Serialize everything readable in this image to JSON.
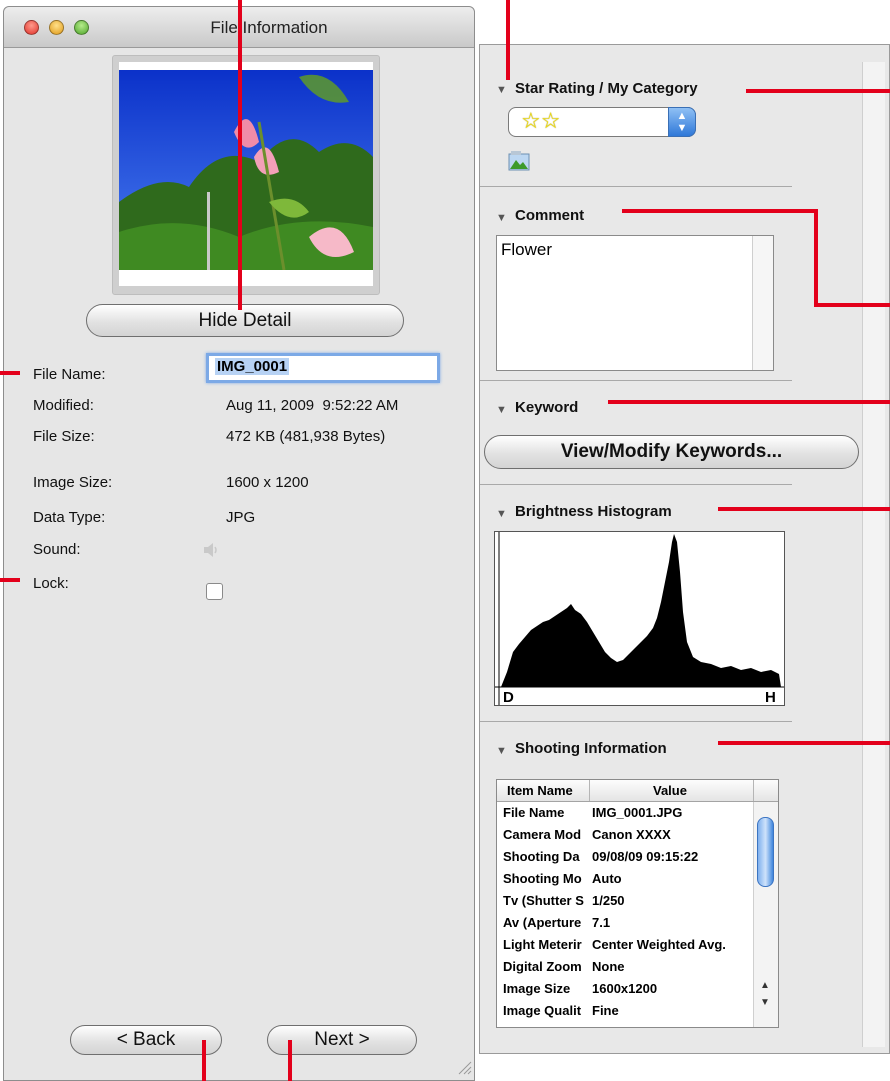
{
  "window": {
    "title": "File Information"
  },
  "left": {
    "hide_detail_label": "Hide Detail",
    "fields": {
      "file_name_label": "File Name:",
      "file_name_value": "IMG_0001",
      "modified_label": "Modified:",
      "modified_value": "Aug 11, 2009  9:52:22 AM",
      "file_size_label": "File Size:",
      "file_size_value": "472 KB (481,938 Bytes)",
      "image_size_label": "Image Size:",
      "image_size_value": "1600 x 1200",
      "data_type_label": "Data Type:",
      "data_type_value": "JPG",
      "sound_label": "Sound:",
      "lock_label": "Lock:"
    },
    "back_label": "< Back",
    "next_label": "Next >"
  },
  "right": {
    "star_section": {
      "title": "Star Rating / My Category",
      "rating": 2,
      "stars": "☆☆"
    },
    "comment_section": {
      "title": "Comment",
      "text": "Flower"
    },
    "keyword_section": {
      "title": "Keyword",
      "button_label": "View/Modify Keywords..."
    },
    "histogram_section": {
      "title": "Brightness Histogram",
      "left_label": "D",
      "right_label": "H"
    },
    "shooting_section": {
      "title": "Shooting Information",
      "columns": [
        "Item Name",
        "Value"
      ],
      "rows": [
        {
          "name": "File Name",
          "value": "IMG_0001.JPG"
        },
        {
          "name": "Camera Mod",
          "value": "Canon XXXX"
        },
        {
          "name": "Shooting Da",
          "value": "09/08/09 09:15:22"
        },
        {
          "name": "Shooting Mo",
          "value": "Auto"
        },
        {
          "name": "Tv (Shutter S",
          "value": "1/250"
        },
        {
          "name": "Av (Aperture",
          "value": "7.1"
        },
        {
          "name": "Light Meterir",
          "value": "Center Weighted Avg."
        },
        {
          "name": "Digital Zoom",
          "value": "None"
        },
        {
          "name": "Image Size",
          "value": "1600x1200"
        },
        {
          "name": "Image Qualit",
          "value": "Fine"
        }
      ]
    }
  },
  "colors": {
    "callout": "#e3001b",
    "focus": "#7ca9e6"
  }
}
